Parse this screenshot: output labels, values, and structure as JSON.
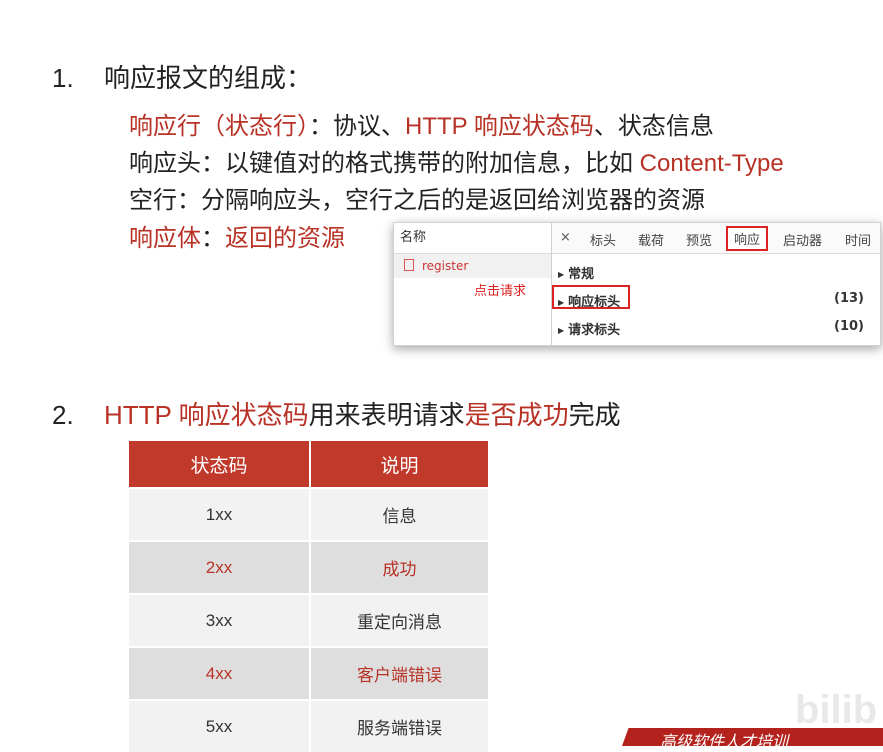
{
  "section1": {
    "number": "1.",
    "title": "响应报文的组成：",
    "lines": [
      {
        "parts": [
          {
            "text": "响应行（状态行）",
            "color": "#b83226"
          },
          {
            "text": "：协议、",
            "color": "#222222"
          },
          {
            "text": "HTTP 响应状态码",
            "color": "#b83226"
          },
          {
            "text": "、状态信息",
            "color": "#222222"
          }
        ]
      },
      {
        "parts": [
          {
            "text": "响应头：以键值对的格式携带的附加信息，比如 ",
            "color": "#222222"
          },
          {
            "text": "Content-Type",
            "color": "#b83226"
          }
        ]
      },
      {
        "parts": [
          {
            "text": "空行：分隔响应头，空行之后的是返回给浏览器的资源",
            "color": "#222222"
          }
        ]
      },
      {
        "parts": [
          {
            "text": "响应体",
            "color": "#b83226"
          },
          {
            "text": "：",
            "color": "#222222"
          },
          {
            "text": "返回的资源",
            "color": "#b83226"
          }
        ]
      }
    ]
  },
  "devtools": {
    "name_header": "名称",
    "request_name": "register",
    "click_hint": "点击请求",
    "tabs": [
      "×",
      "标头",
      "载荷",
      "预览",
      "响应",
      "启动器",
      "时间"
    ],
    "active_tab": "响应",
    "sections": [
      {
        "label": "常规",
        "count": ""
      },
      {
        "label": "响应标头",
        "count": "(13)"
      },
      {
        "label": "请求标头",
        "count": "(10)"
      }
    ]
  },
  "section2": {
    "number": "2.",
    "title_parts": [
      {
        "text": "HTTP 响应状态码",
        "color": "#b83226"
      },
      {
        "text": "用来表明请求",
        "color": "#222222"
      },
      {
        "text": "是否成功",
        "color": "#b83226"
      },
      {
        "text": "完成",
        "color": "#222222"
      }
    ]
  },
  "table": {
    "headers": [
      "状态码",
      "说明"
    ],
    "rows": [
      [
        "1xx",
        "信息"
      ],
      [
        "2xx",
        "成功"
      ],
      [
        "3xx",
        "重定向消息"
      ],
      [
        "4xx",
        "客户端错误"
      ],
      [
        "5xx",
        "服务端错误"
      ]
    ]
  },
  "footer": {
    "watermark": "bilib",
    "banner_text": "高级软件人才培训"
  }
}
